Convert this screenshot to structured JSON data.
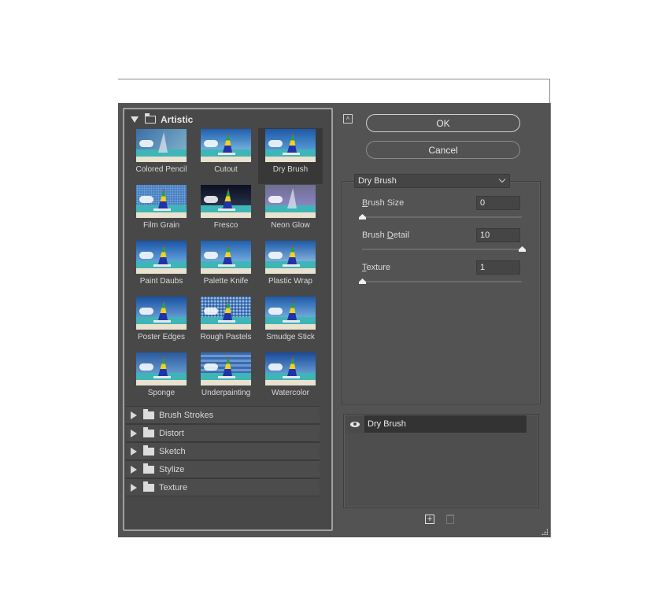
{
  "dialog": {
    "ok_label": "OK",
    "cancel_label": "Cancel",
    "collapse_icon": "collapse-up-icon"
  },
  "categories": {
    "open": {
      "name": "Artistic",
      "filters": [
        {
          "label": "Colored Pencil",
          "selected": false
        },
        {
          "label": "Cutout",
          "selected": false
        },
        {
          "label": "Dry Brush",
          "selected": true
        },
        {
          "label": "Film Grain",
          "selected": false
        },
        {
          "label": "Fresco",
          "selected": false
        },
        {
          "label": "Neon Glow",
          "selected": false
        },
        {
          "label": "Paint Daubs",
          "selected": false
        },
        {
          "label": "Palette Knife",
          "selected": false
        },
        {
          "label": "Plastic Wrap",
          "selected": false
        },
        {
          "label": "Poster Edges",
          "selected": false
        },
        {
          "label": "Rough Pastels",
          "selected": false
        },
        {
          "label": "Smudge Stick",
          "selected": false
        },
        {
          "label": "Sponge",
          "selected": false
        },
        {
          "label": "Underpainting",
          "selected": false
        },
        {
          "label": "Watercolor",
          "selected": false
        }
      ]
    },
    "collapsed": [
      "Brush Strokes",
      "Distort",
      "Sketch",
      "Stylize",
      "Texture"
    ]
  },
  "settings": {
    "filter_select": "Dry Brush",
    "params": [
      {
        "label_mnemonic": "B",
        "label_rest": "rush Size",
        "value": "0",
        "slider_fraction": 0.0
      },
      {
        "label_pre": "Brush ",
        "label_mnemonic": "D",
        "label_rest": "etail",
        "value": "10",
        "slider_fraction": 1.0
      },
      {
        "label_mnemonic": "T",
        "label_rest": "exture",
        "value": "1",
        "slider_fraction": 0.0
      }
    ]
  },
  "layers": {
    "items": [
      {
        "name": "Dry Brush",
        "visible": true
      }
    ],
    "add_icon": "new-layer-icon",
    "delete_icon": "trash-icon"
  }
}
